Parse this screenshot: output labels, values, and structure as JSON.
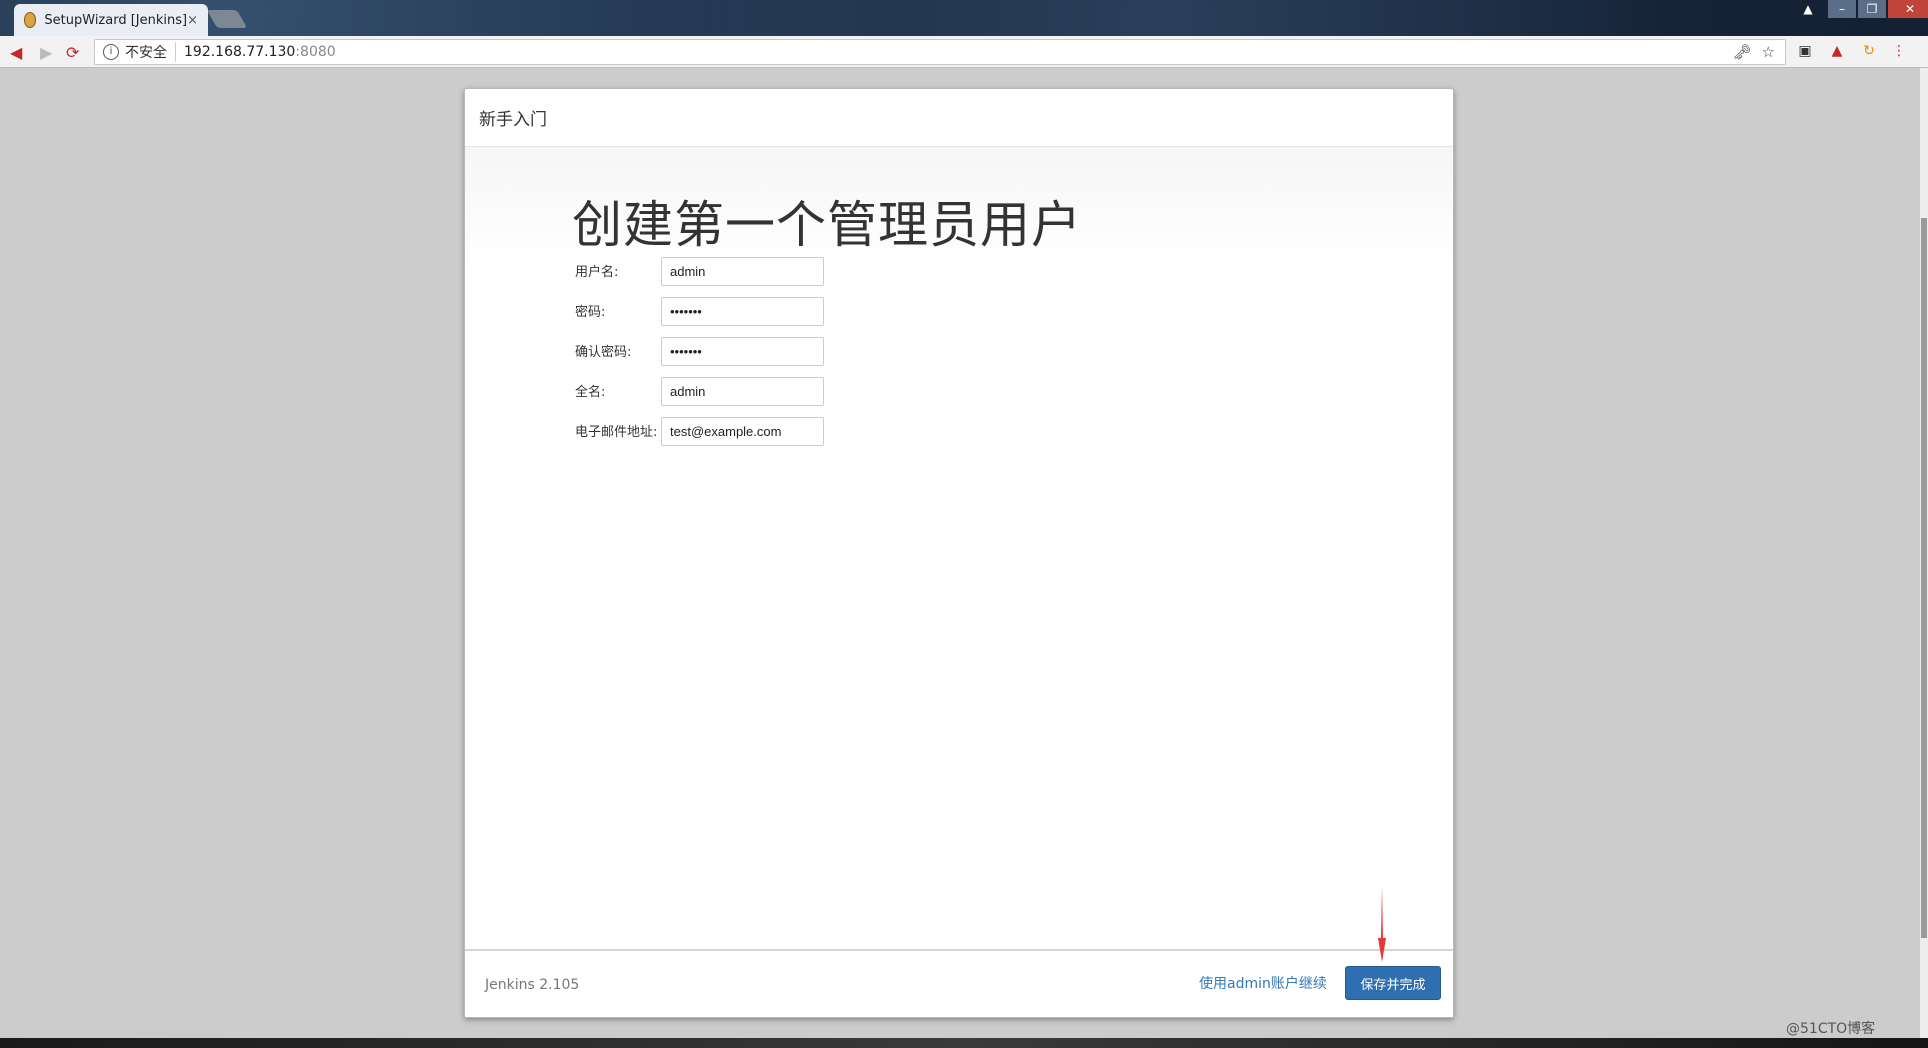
{
  "browser": {
    "tab_title": "SetupWizard [Jenkins]",
    "tab_close": "×",
    "security_label": "不安全",
    "url_host": "192.168.77.130",
    "url_port": ":8080",
    "icons": [
      "back-icon",
      "forward-icon",
      "reload-icon",
      "info-icon",
      "key-icon",
      "star-icon",
      "close-icon"
    ],
    "accent_color": "#c62828"
  },
  "wizard": {
    "header_title": "新手入门",
    "page_title": "创建第一个管理员用户",
    "fields": [
      {
        "label": "用户名:",
        "value": "admin",
        "type": "text"
      },
      {
        "label": "密码:",
        "value": "•••••••",
        "type": "password"
      },
      {
        "label": "确认密码:",
        "value": "•••••••",
        "type": "password"
      },
      {
        "label": "全名:",
        "value": "admin",
        "type": "text"
      },
      {
        "label": "电子邮件地址:",
        "value": "test@example.com",
        "type": "text"
      }
    ],
    "footer": {
      "version": "Jenkins 2.105",
      "skip_link": "使用admin账户继续",
      "save_button": "保存并完成"
    },
    "button_color": "#2f6fb0",
    "link_color": "#337ab7"
  },
  "watermark": "@51CTO博客"
}
